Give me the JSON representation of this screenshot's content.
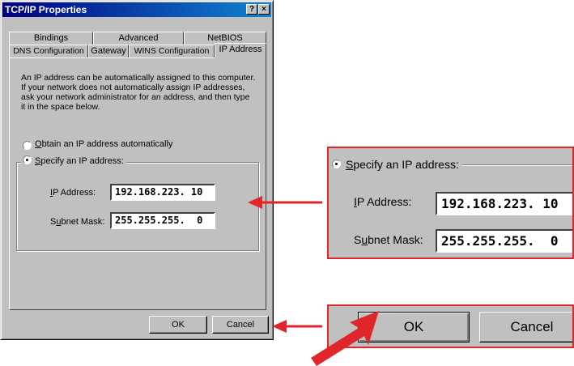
{
  "window": {
    "title": "TCP/IP Properties",
    "help_glyph": "?",
    "close_glyph": "×"
  },
  "tabs": {
    "back_row": [
      "Bindings",
      "Advanced",
      "NetBIOS"
    ],
    "front_row": [
      "DNS Configuration",
      "Gateway",
      "WINS Configuration",
      "IP Address"
    ],
    "active": "IP Address"
  },
  "panel": {
    "description": "An IP address can be automatically assigned to this computer. If your network does not automatically assign IP addresses, ask your network administrator for an address, and then type it in the space below.",
    "obtain_auto": {
      "label_mnemonic": "O",
      "label_rest": "btain an IP address automatically",
      "selected": false
    },
    "specify": {
      "label_mnemonic": "S",
      "label_rest": "pecify an IP address:",
      "selected": true
    },
    "ip_label_mnemonic": "I",
    "ip_label_rest": "P Address:",
    "ip_value": "192.168.223. 10",
    "subnet_label_pre": "S",
    "subnet_label_mnemonic": "u",
    "subnet_label_rest": "bnet Mask:",
    "subnet_value": "255.255.255.  0"
  },
  "buttons": {
    "ok": "OK",
    "cancel": "Cancel"
  },
  "colors": {
    "annotation_red": "#e0262a",
    "titlebar": "#000080"
  }
}
